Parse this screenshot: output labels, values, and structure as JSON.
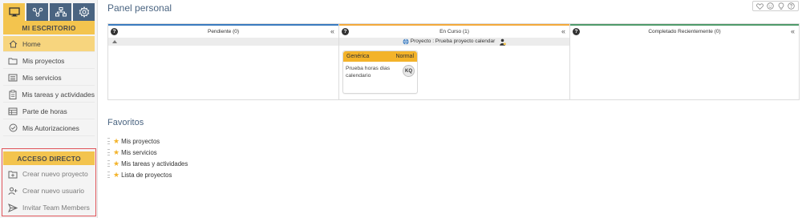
{
  "sidebar": {
    "top_icons": [
      {
        "name": "monitor-icon",
        "active": true
      },
      {
        "name": "sitemap-icon",
        "active": false
      },
      {
        "name": "org-chart-icon",
        "active": false
      },
      {
        "name": "gear-icon",
        "active": false
      }
    ],
    "section_title": "MI ESCRITORIO",
    "items": [
      {
        "label": "Home",
        "icon": "home-icon"
      },
      {
        "label": "Mis proyectos",
        "icon": "folder-icon"
      },
      {
        "label": "Mis servicios",
        "icon": "list-icon"
      },
      {
        "label": "Mis tareas y actividades",
        "icon": "clipboard-icon"
      },
      {
        "label": "Parte de horas",
        "icon": "timesheet-icon"
      },
      {
        "label": "Mis Autorizaciones",
        "icon": "check-circle-icon"
      }
    ],
    "shortcuts_title": "ACCESO DIRECTO",
    "shortcuts": [
      {
        "label": "Crear nuevo proyecto",
        "icon": "folder-plus-icon"
      },
      {
        "label": "Crear nuevo usuario",
        "icon": "user-plus-icon"
      },
      {
        "label": "Invitar Team Members",
        "icon": "send-icon"
      }
    ]
  },
  "main": {
    "title": "Panel personal",
    "top_actions": [
      "heart-icon",
      "smile-icon",
      "lightbulb-icon",
      "help-icon"
    ],
    "board": {
      "columns": [
        {
          "title": "Pendiente (0)",
          "color": "#3a7bbf"
        },
        {
          "title": "En Curso (1)",
          "color": "#f3a93b"
        },
        {
          "title": "Completado Recientemente (0)",
          "color": "#4f9a6a"
        }
      ],
      "project_label": "Proyecto : Prueba proyecto calendar",
      "card": {
        "type": "Genérica",
        "priority": "Normal",
        "title": "Prueba horas dias calendario",
        "assignee": "KQ"
      }
    },
    "favorites_title": "Favoritos",
    "favorites": [
      "Mis proyectos",
      "Mis servicios",
      "Mis tareas y actividades",
      "Lista de proyectos"
    ]
  },
  "colors": {
    "accent": "#f3c44e",
    "nav_dark": "#4a6481",
    "card_header": "#f3b32a",
    "highlight_border": "#e0565b"
  }
}
